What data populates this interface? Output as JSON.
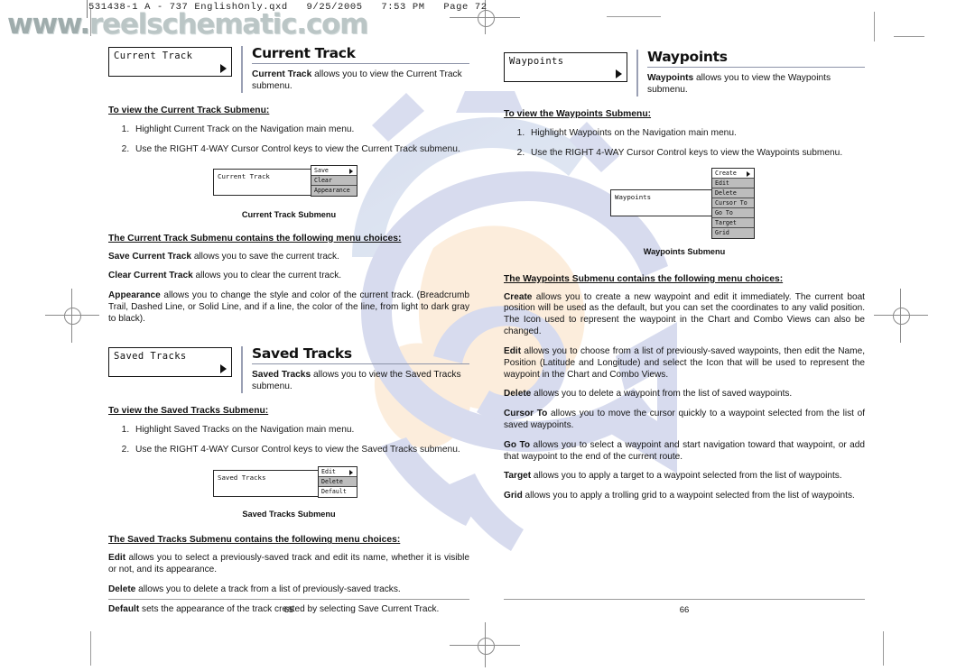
{
  "scan_header": {
    "text": "531438-1 A - 737 EnglishOnly.qxd   9/25/2005   7:53 PM   Page 72"
  },
  "watermark": {
    "url_prefix": "www.",
    "url_main": "reelschematic.com",
    "full": "www.reelschematic.com"
  },
  "left_page": {
    "number": "65",
    "sections": [
      {
        "chip_label": "Current Track",
        "title": "Current Track",
        "lede_bold": "Current Track",
        "lede_rest": " allows you to view the Current Track submenu.",
        "subhead": "To view the Current Track Submenu:",
        "steps": [
          "Highlight Current Track on the Navigation main menu.",
          "Use the RIGHT 4-WAY Cursor Control keys to view the Current Track submenu."
        ],
        "figure": {
          "lcd_label": "Current Track",
          "caption": "Current Track Submenu",
          "items": [
            {
              "label": "Save",
              "arrow": true,
              "shade": false
            },
            {
              "label": "Clear",
              "arrow": false,
              "shade": true
            },
            {
              "label": "Appearance",
              "arrow": false,
              "shade": true
            }
          ]
        },
        "def_head": "The Current Track Submenu contains the following menu choices:",
        "defs": [
          {
            "term": "Save Current Track",
            "text": " allows you to save the current track."
          },
          {
            "term": "Clear Current Track",
            "text": " allows you to clear the current track."
          },
          {
            "term": "Appearance",
            "text": " allows you to change the style and color of the current track. (Breadcrumb Trail, Dashed Line, or Solid Line, and if a line, the color of the line, from light to dark gray to black)."
          }
        ]
      },
      {
        "chip_label": "Saved Tracks",
        "title": "Saved Tracks",
        "lede_bold": "Saved Tracks",
        "lede_rest": " allows you to view the Saved Tracks submenu.",
        "subhead": "To view the Saved Tracks Submenu:",
        "steps": [
          "Highlight Saved Tracks on the Navigation main menu.",
          "Use the RIGHT 4-WAY Cursor Control keys to view the Saved Tracks submenu."
        ],
        "figure": {
          "lcd_label": "Saved Tracks",
          "caption": "Saved Tracks Submenu",
          "items": [
            {
              "label": "Edit",
              "arrow": true,
              "shade": false
            },
            {
              "label": "Delete",
              "arrow": false,
              "shade": true
            },
            {
              "label": "Default",
              "arrow": false,
              "shade": false
            }
          ]
        },
        "def_head": "The Saved Tracks Submenu contains the following menu choices:",
        "defs": [
          {
            "term": "Edit",
            "text": " allows you to select a previously-saved track and edit its name, whether it is visible or not, and its appearance."
          },
          {
            "term": "Delete",
            "text": " allows you to delete a track from a list of previously-saved tracks."
          },
          {
            "term": "Default",
            "text": " sets the appearance of the track created by selecting Save Current Track."
          }
        ]
      }
    ]
  },
  "right_page": {
    "number": "66",
    "sections": [
      {
        "chip_label": "Waypoints",
        "title": "Waypoints",
        "lede_bold": "Waypoints",
        "lede_rest": " allows you to view the Waypoints submenu.",
        "subhead": "To view the Waypoints Submenu:",
        "steps": [
          "Highlight Waypoints on the Navigation main menu.",
          "Use the RIGHT 4-WAY Cursor Control keys to view the Waypoints submenu."
        ],
        "figure": {
          "lcd_label": "Waypoints",
          "caption": "Waypoints Submenu",
          "items": [
            {
              "label": "Create",
              "arrow": true,
              "shade": false
            },
            {
              "label": "Edit",
              "arrow": false,
              "shade": true
            },
            {
              "label": "Delete",
              "arrow": false,
              "shade": true
            },
            {
              "label": "Cursor To",
              "arrow": false,
              "shade": true
            },
            {
              "label": "Go To",
              "arrow": false,
              "shade": true
            },
            {
              "label": "Target",
              "arrow": false,
              "shade": true
            },
            {
              "label": "Grid",
              "arrow": false,
              "shade": true
            }
          ]
        },
        "def_head": "The Waypoints Submenu contains the following menu choices:",
        "defs": [
          {
            "term": "Create",
            "text": " allows you to create a new waypoint and edit it immediately.  The current boat position will be used as the default, but you can set the coordinates to any valid position. The Icon used to represent the waypoint in the Chart and Combo Views can also be changed."
          },
          {
            "term": "Edit",
            "text": " allows you to choose from a list of previously-saved waypoints, then edit the Name, Position (Latitude and Longitude) and select the Icon that will be used to represent the waypoint in the Chart and Combo Views."
          },
          {
            "term": "Delete",
            "text": " allows you to delete a waypoint from the list of saved waypoints."
          },
          {
            "term": "Cursor To",
            "text": " allows you to move the cursor quickly to a waypoint selected from the list of saved waypoints."
          },
          {
            "term": "Go To",
            "text": " allows you to select a waypoint and start navigation toward that waypoint, or add that waypoint to the end of the current route."
          },
          {
            "term": "Target",
            "text": " allows you to apply a target to a waypoint selected from the list of waypoints."
          },
          {
            "term": "Grid",
            "text": " allows you to apply a trolling grid to a waypoint selected from the list of waypoints."
          }
        ]
      }
    ]
  },
  "colors": {
    "rule": "#8c93a8",
    "watermark_text": "#b8c4c4",
    "logo_blue": "#b9c0de",
    "logo_peach": "#fbe0c4",
    "menu_shade": "#bdbdbd"
  }
}
